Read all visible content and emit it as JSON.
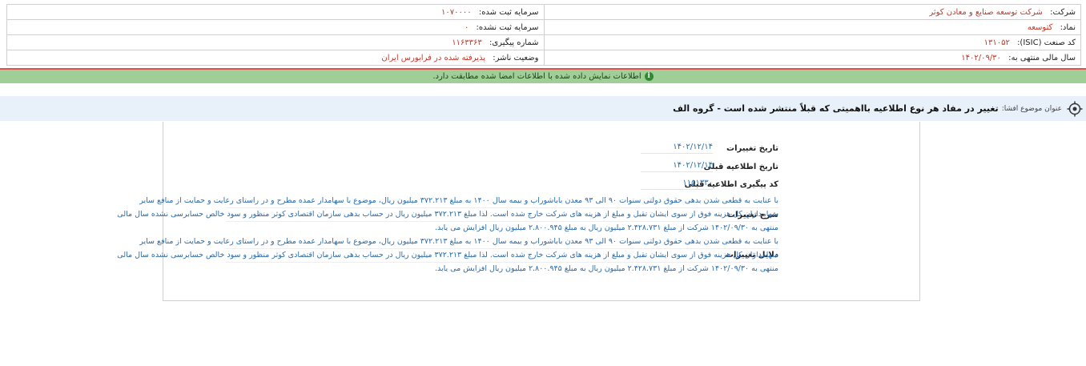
{
  "info": {
    "company_label": "شرکت:",
    "company_value": "شرکت توسعه صنایع و معادن کوثر",
    "capital_label": "سرمایه ثبت شده:",
    "capital_value": "۱۰۷۰۰۰۰",
    "symbol_label": "نماد:",
    "symbol_value": "کتوسعه",
    "unregistered_label": "سرمایه ثبت نشده:",
    "unregistered_value": "۰",
    "isic_label": "کد صنعت (ISIC):",
    "isic_value": "۱۳۱۰۵۲",
    "tracking_label": "شماره پیگیری:",
    "tracking_value": "۱۱۶۳۳۶۳",
    "fiscal_label": "سال مالی منتهی به:",
    "fiscal_value": "۱۴۰۲/۰۹/۳۰",
    "status_label": "وضعیت ناشر:",
    "status_value": "پذیرفته شده در فرابورس ایران"
  },
  "notice": {
    "icon": "info-icon",
    "text": "اطلاعات نمایش داده شده با اطلاعات امضا شده مطابقت دارد."
  },
  "subject": {
    "icon": "target-icon",
    "label": "عنوان موضوع افشا:",
    "title": "تغییر در مفاد هر نوع اطلاعیه بااهمیتی که قبلاً منتشر شده است - گروه الف"
  },
  "details": {
    "changes_date_label": "تاریخ تغییرات",
    "changes_date_value": "۱۴۰۲/۱۲/۱۴",
    "prev_date_label": "تاریخ اطلاعیه قبلی",
    "prev_date_value": "۱۴۰۲/۱۲/۱۴",
    "prev_code_label": "کد پیگیری اطلاعیه قبلی",
    "prev_code_value": "۱۱۵۱۳۳۰",
    "description_label": "شرح تغییرات",
    "description_lines": [
      "با عنایت به قطعی شدن بدهی حقوق دولتی سنوات ۹۰ الی ۹۳ معدن باباشوراب و بیمه سال ۱۴۰۰ به مبلغ ۳۷۲.۲۱۳ میلیون ریال، موضوع با سهامدار عمده مطرح و در راستای رعایت و حمایت از منافع سایر",
      "سهامداران کل هزینه فوق از سوی ایشان تقبل و مبلغ از هزینه های شرکت خارج شده است. لذا مبلغ ۳۷۲.۲۱۳ میلیون ریال در حساب بدهی سازمان اقتصادی کوثر منظور و سود خالص حسابرسی نشده سال مالی",
      "منتهی به ۱۴۰۲/۰۹/۳۰ شرکت از مبلغ ۲.۴۲۸.۷۳۱ میلیون ریال به مبلغ ۲.۸۰۰.۹۴۵ میلیون ریال افزایش می یابد."
    ],
    "reasons_label": "دلایل تغییرات",
    "reasons_lines": [
      "با عنایت به قطعی شدن بدهی حقوق دولتی سنوات ۹۰ الی ۹۳ معدن باباشوراب و بیمه سال ۱۴۰۰ به مبلغ ۳۷۲.۲۱۳ میلیون ریال، موضوع با سهامدار عمده مطرح و در راستای رعایت و حمایت از منافع سایر",
      "سهامداران کل هزینه فوق از سوی ایشان تقبل و مبلغ از هزینه های شرکت خارج شده است. لذا مبلغ ۳۷۲.۲۱۳ میلیون ریال در حساب بدهی سازمان اقتصادی کوثر منظور و سود خالص حسابرسی نشده سال مالی",
      "منتهی به ۱۴۰۲/۰۹/۳۰ شرکت از مبلغ ۲.۴۲۸.۷۳۱ میلیون ریال به مبلغ ۲.۸۰۰.۹۴۵ میلیون ریال افزایش می یابد."
    ]
  }
}
